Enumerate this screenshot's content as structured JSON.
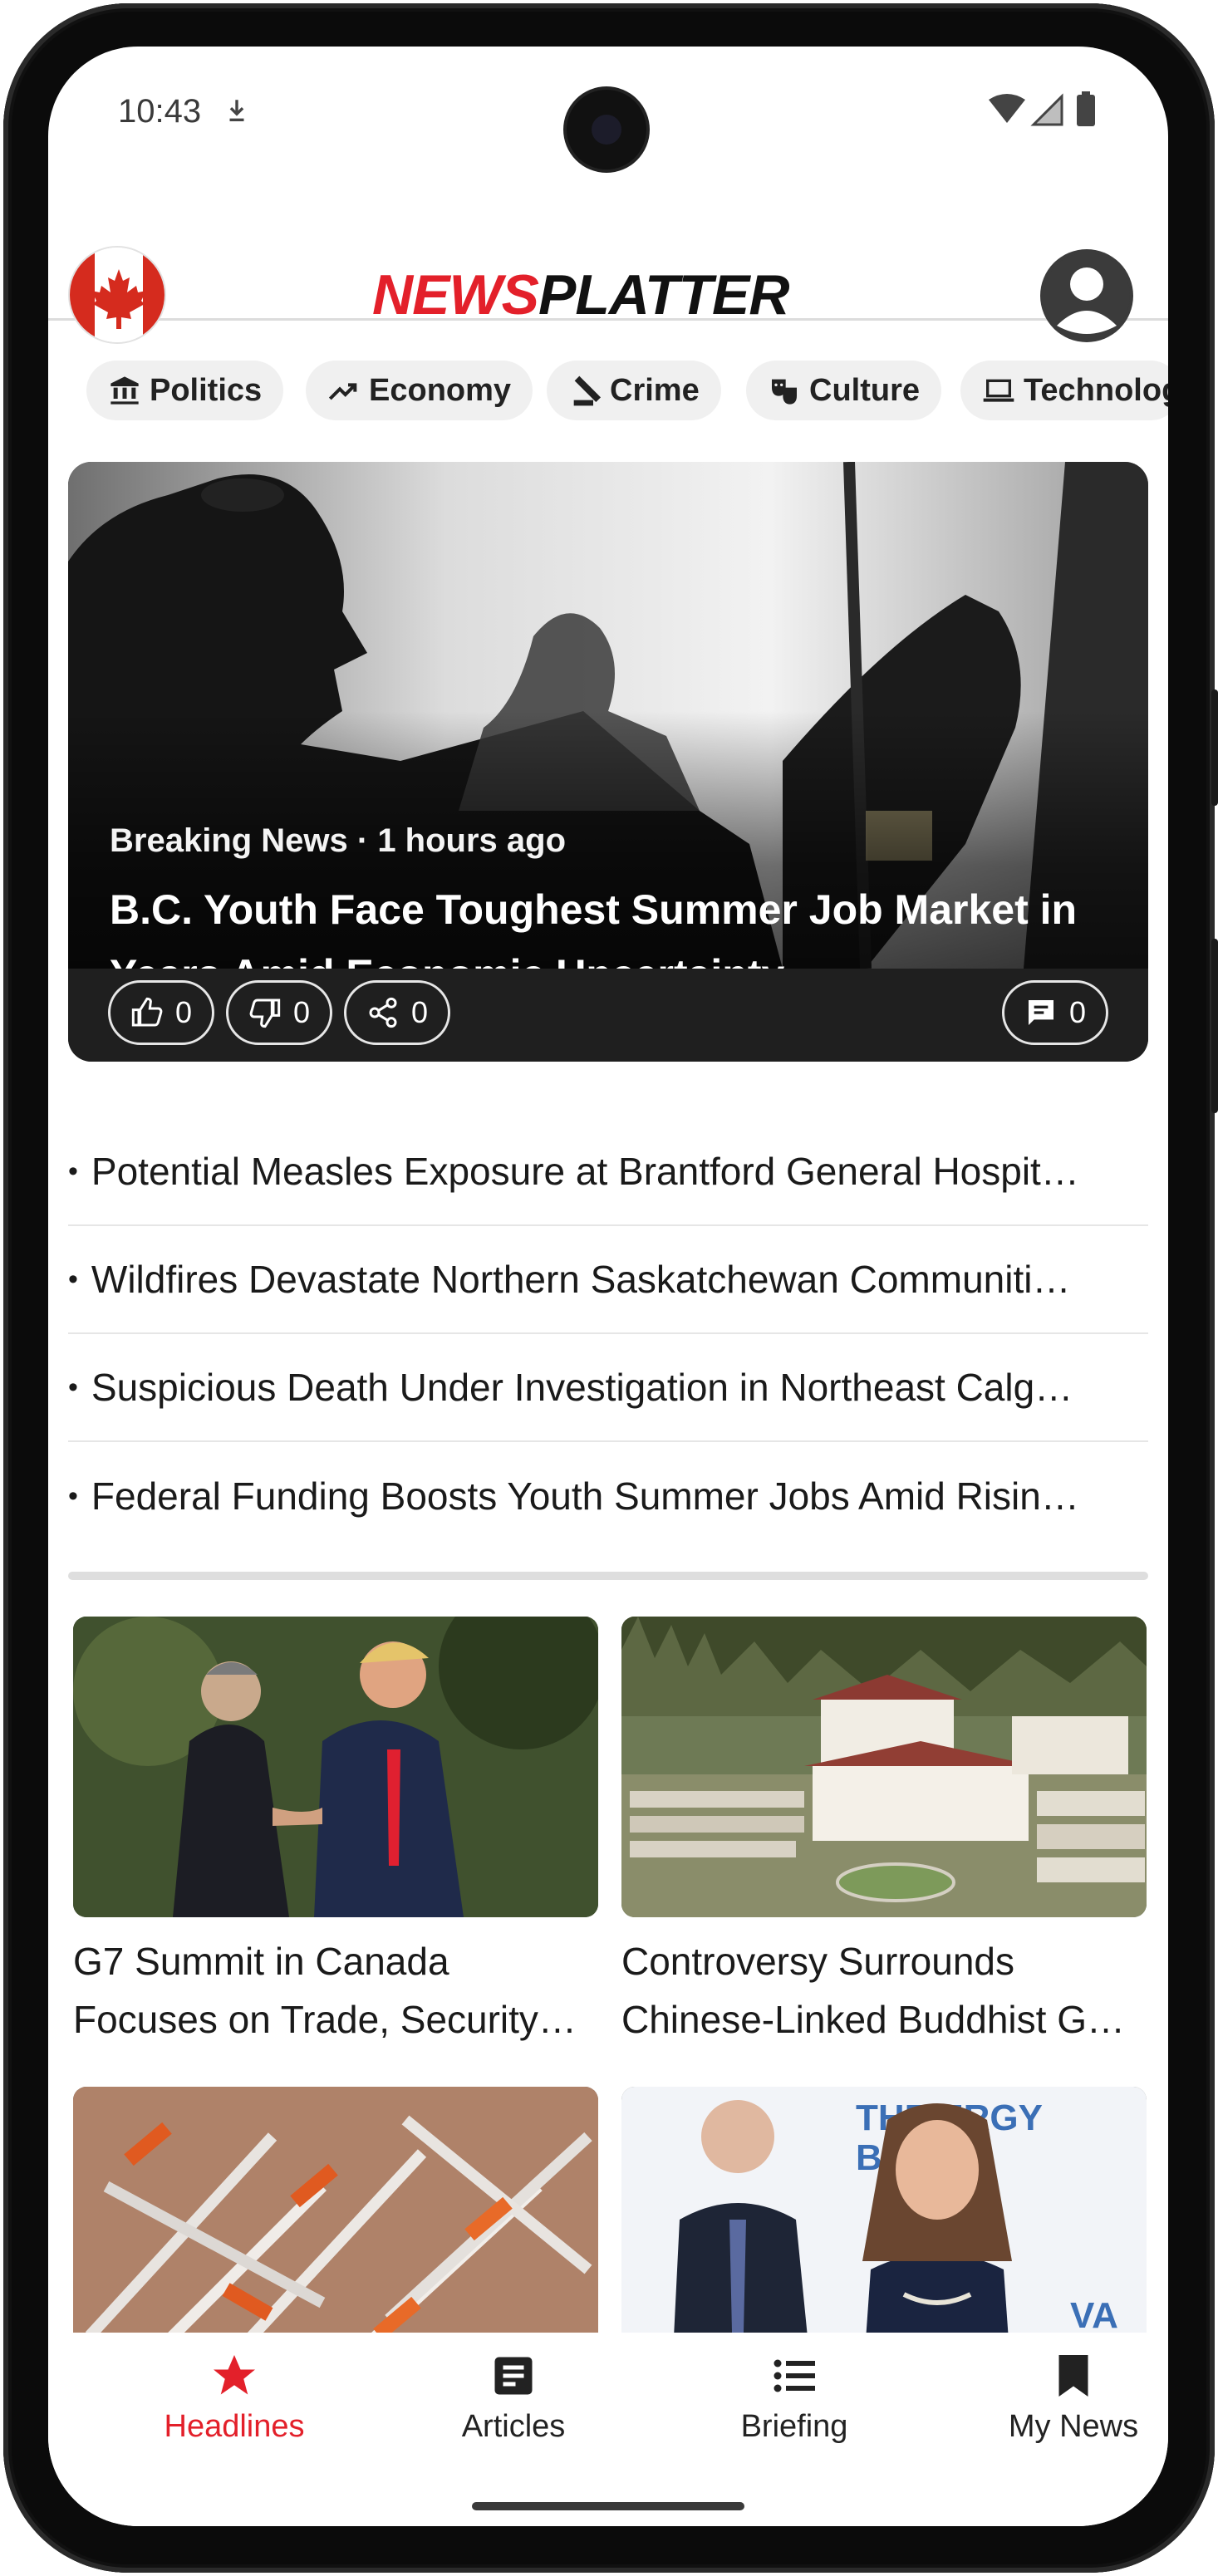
{
  "status_bar": {
    "time": "10:43"
  },
  "header": {
    "logo_part1": "NEWS",
    "logo_part2": "PLATTER"
  },
  "categories": [
    {
      "label": "Politics",
      "icon": "institution-icon"
    },
    {
      "label": "Economy",
      "icon": "trending-up-icon"
    },
    {
      "label": "Crime",
      "icon": "gavel-icon"
    },
    {
      "label": "Culture",
      "icon": "theater-masks-icon"
    },
    {
      "label": "Technolog",
      "icon": "laptop-icon"
    }
  ],
  "hero": {
    "meta": "Breaking News · 1 hours ago",
    "title": "B.C. Youth Face Toughest Summer Job Market in Years Amid Economic Uncertainty",
    "likes": "0",
    "dislikes": "0",
    "shares": "0",
    "comments": "0"
  },
  "headlines": [
    "Potential Measles Exposure at Brantford General Hospit…",
    "Wildfires Devastate Northern Saskatchewan Communiti…",
    "Suspicious Death Under Investigation in Northeast Calg…",
    "Federal Funding Boosts Youth Summer Jobs Amid Risin…"
  ],
  "cards": [
    {
      "title": "G7 Summit in Canada Focuses on Trade, Security…"
    },
    {
      "title": "Controversy Surrounds Chinese-Linked Buddhist G…"
    },
    {
      "title": ""
    },
    {
      "title": ""
    }
  ],
  "card_image_text": {
    "sign_line1": "THE ERGY",
    "sign_line2": "BE THE",
    "sign_line3": "VA"
  },
  "bottom_nav": [
    {
      "label": "Headlines",
      "icon": "star-icon",
      "active": true
    },
    {
      "label": "Articles",
      "icon": "article-icon",
      "active": false
    },
    {
      "label": "Briefing",
      "icon": "list-icon",
      "active": false
    },
    {
      "label": "My News",
      "icon": "bookmark-icon",
      "active": false
    }
  ],
  "colors": {
    "brand_red": "#e3202a",
    "text_dark": "#1a1a1a",
    "chip_bg": "#f0f0f0"
  }
}
